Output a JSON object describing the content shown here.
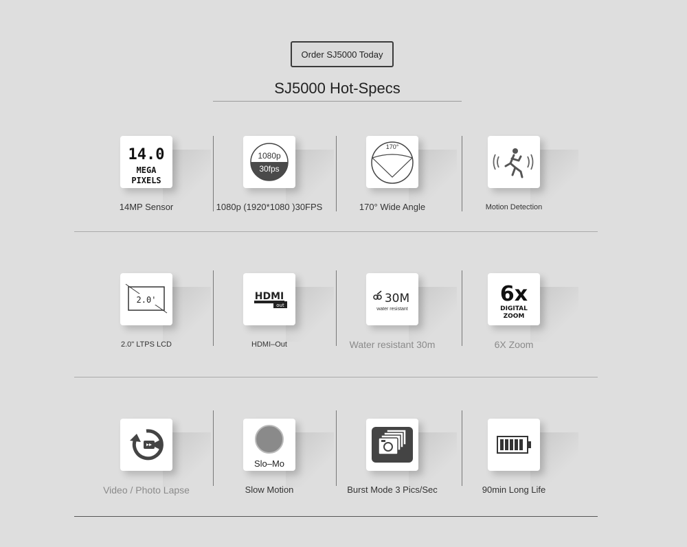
{
  "order_button": "Order SJ5000 Today",
  "title": "SJ5000 Hot-Specs",
  "specs": [
    {
      "label": "14MP Sensor",
      "icon": "megapixel-icon",
      "tile_text": [
        "14.0",
        "MEGA",
        "PIXELS"
      ]
    },
    {
      "label": "1080p (1920*1080 )30FPS",
      "icon": "fullhd-30fps-icon",
      "tile_text": [
        "1080p",
        "30fps"
      ]
    },
    {
      "label": "170°  Wide Angle",
      "icon": "wide-angle-icon",
      "tile_text": [
        "170°"
      ]
    },
    {
      "label": "Motion Detection",
      "icon": "motion-detection-icon"
    },
    {
      "label": "2.0\" LTPS LCD",
      "icon": "lcd-screen-icon",
      "tile_text": [
        "2.0'"
      ]
    },
    {
      "label": "HDMI–Out",
      "icon": "hdmi-icon",
      "tile_text": [
        "HDMI",
        "out"
      ]
    },
    {
      "label": "Water resistant 30m",
      "icon": "waterproof-icon",
      "tile_text": [
        "30M",
        "water resistant"
      ]
    },
    {
      "label": "6X Zoom",
      "icon": "digital-zoom-icon",
      "tile_text": [
        "6x",
        "DIGITAL",
        "ZOOM"
      ]
    },
    {
      "label": "Video / Photo Lapse",
      "icon": "time-lapse-icon"
    },
    {
      "label": "Slow Motion",
      "icon": "slow-motion-icon",
      "tile_text": [
        "Slo–Mo"
      ]
    },
    {
      "label": "Burst Mode 3 Pics/Sec",
      "icon": "burst-mode-icon"
    },
    {
      "label": "90min Long Life",
      "icon": "battery-icon"
    }
  ]
}
